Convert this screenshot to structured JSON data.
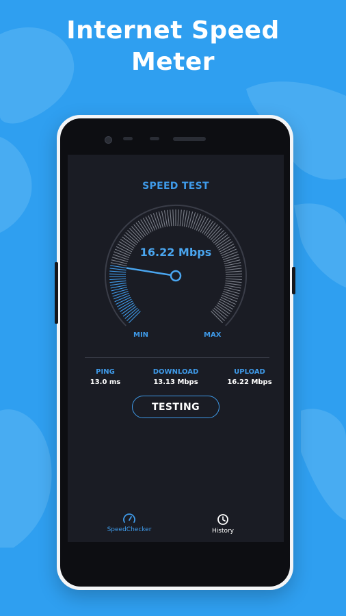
{
  "headline": {
    "line1": "Internet Speed",
    "line2": "Meter"
  },
  "screen": {
    "title": "SPEED TEST",
    "gauge": {
      "reading": "16.22 Mbps",
      "min_label": "MIN",
      "max_label": "MAX",
      "level": 0.2
    },
    "stats": {
      "ping": {
        "label": "PING",
        "value": "13.0 ms"
      },
      "download": {
        "label": "DOWNLOAD",
        "value": "13.13 Mbps"
      },
      "upload": {
        "label": "UPLOAD",
        "value": "16.22 Mbps"
      }
    },
    "action_button": "TESTING",
    "nav": [
      {
        "label": "SpeedChecker",
        "icon": "speedometer-icon",
        "active": true
      },
      {
        "label": "History",
        "icon": "clock-icon",
        "active": false
      }
    ]
  },
  "colors": {
    "background": "#2f9ff0",
    "accent": "#3f9bea",
    "screen": "#1a1c24",
    "phone_body": "#0d0e12"
  }
}
